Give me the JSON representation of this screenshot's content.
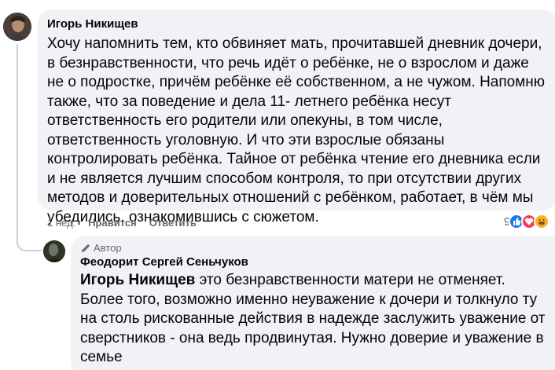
{
  "main_comment": {
    "author": "Игорь Никищев",
    "text": "Хочу напомнить тем, кто обвиняет мать, прочитавшей дневник дочери, в безнравственности, что речь идёт о ребёнке, не о взрослом и даже не о подростке, причём ребёнке её собственном, а не чужом. Напомню также, что за поведение и дела 11- летнего ребёнка несут ответственность его родители или опекуны, в том числе, ответственность уголовную. И что эти взрослые обязаны контролировать ребёнка. Тайное от ребёнка чтение его дневника если и не является лучшим способом контроля, то при отсутствии других методов и доверительных отношений с ребёнком, работает, в чём мы убедились, ознакомившись с сюжетом.",
    "time": "1 нед.",
    "like_label": "Нравится",
    "reply_label": "Ответить",
    "reaction_count": "9",
    "reaction_icons": [
      "like-icon",
      "love-icon",
      "haha-icon"
    ],
    "colors": {
      "like": "#1877f2",
      "love": "#f33e58",
      "haha": "#f7b125"
    }
  },
  "reply": {
    "badge": "Автор",
    "author": "Феодорит Сергей Сеньчуков",
    "mention": "Игорь Никищев",
    "text": " это безнравственности матери не отменяет. Более того, возможно именно неуважение к дочери и толкнуло ту на столь рискованные действия в надежде заслужить уважение от сверстников - она ведь продвинутая. Нужно доверие и уважение в семье"
  }
}
